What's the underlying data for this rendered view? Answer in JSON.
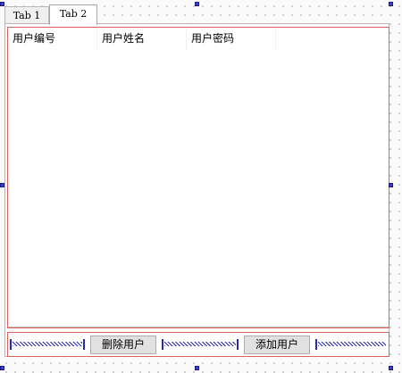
{
  "tabs": [
    {
      "label": "Tab 1",
      "active": false
    },
    {
      "label": "Tab 2",
      "active": true
    }
  ],
  "table": {
    "headers": [
      "用户编号",
      "用户姓名",
      "用户密码"
    ],
    "rows": []
  },
  "buttons": {
    "delete_label": "删除用户",
    "add_label": "添加用户"
  },
  "colors": {
    "layout_outline": "#e06060",
    "selection_handle": "#3c3cd6",
    "spacer": "#2a2aa8"
  }
}
